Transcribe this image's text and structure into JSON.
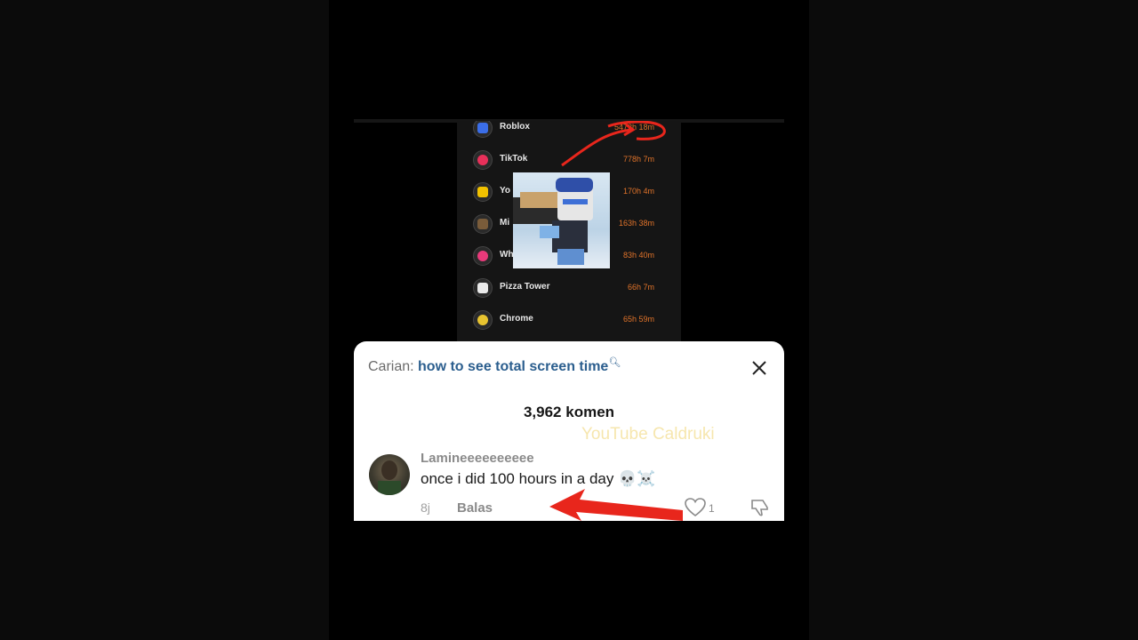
{
  "screen_time": {
    "apps": [
      {
        "name": "Roblox",
        "time": "5472h 18m",
        "icon": "roblox-icon",
        "color": "#3b6ee8"
      },
      {
        "name": "TikTok",
        "time": "778h 7m",
        "icon": "tiktok-icon",
        "color": "#e8305a"
      },
      {
        "name": "Yo",
        "time": "170h 4m",
        "icon": "youtube-icon",
        "color": "#f2c200"
      },
      {
        "name": "Mi",
        "time": "163h 38m",
        "icon": "minecraft-icon",
        "color": "#7a5c3a"
      },
      {
        "name": "Wh",
        "time": "83h 40m",
        "icon": "app-icon",
        "color": "#e83a7a"
      },
      {
        "name": "Pizza Tower",
        "time": "66h 7m",
        "icon": "pizza-tower-icon",
        "color": "#eaeaea"
      },
      {
        "name": "Chrome",
        "time": "65h 59m",
        "icon": "chrome-icon",
        "color": "#e8c430"
      }
    ]
  },
  "comments_sheet": {
    "search_prefix": "Carian:",
    "search_query": "how to see total screen time",
    "search_glyph": "🔍︎",
    "count_label": "3,962 komen",
    "watermark": "YouTube Caldruki",
    "comment": {
      "username": "Lamineeeeeeeeee",
      "text": "once i did 100 hours in a day 💀☠️",
      "age": "8j",
      "reply_label": "Balas",
      "like_count": "1"
    }
  },
  "colors": {
    "accent_orange": "#e0732a",
    "search_blue": "#2b5e8e",
    "arrow_red": "#e8261c"
  }
}
